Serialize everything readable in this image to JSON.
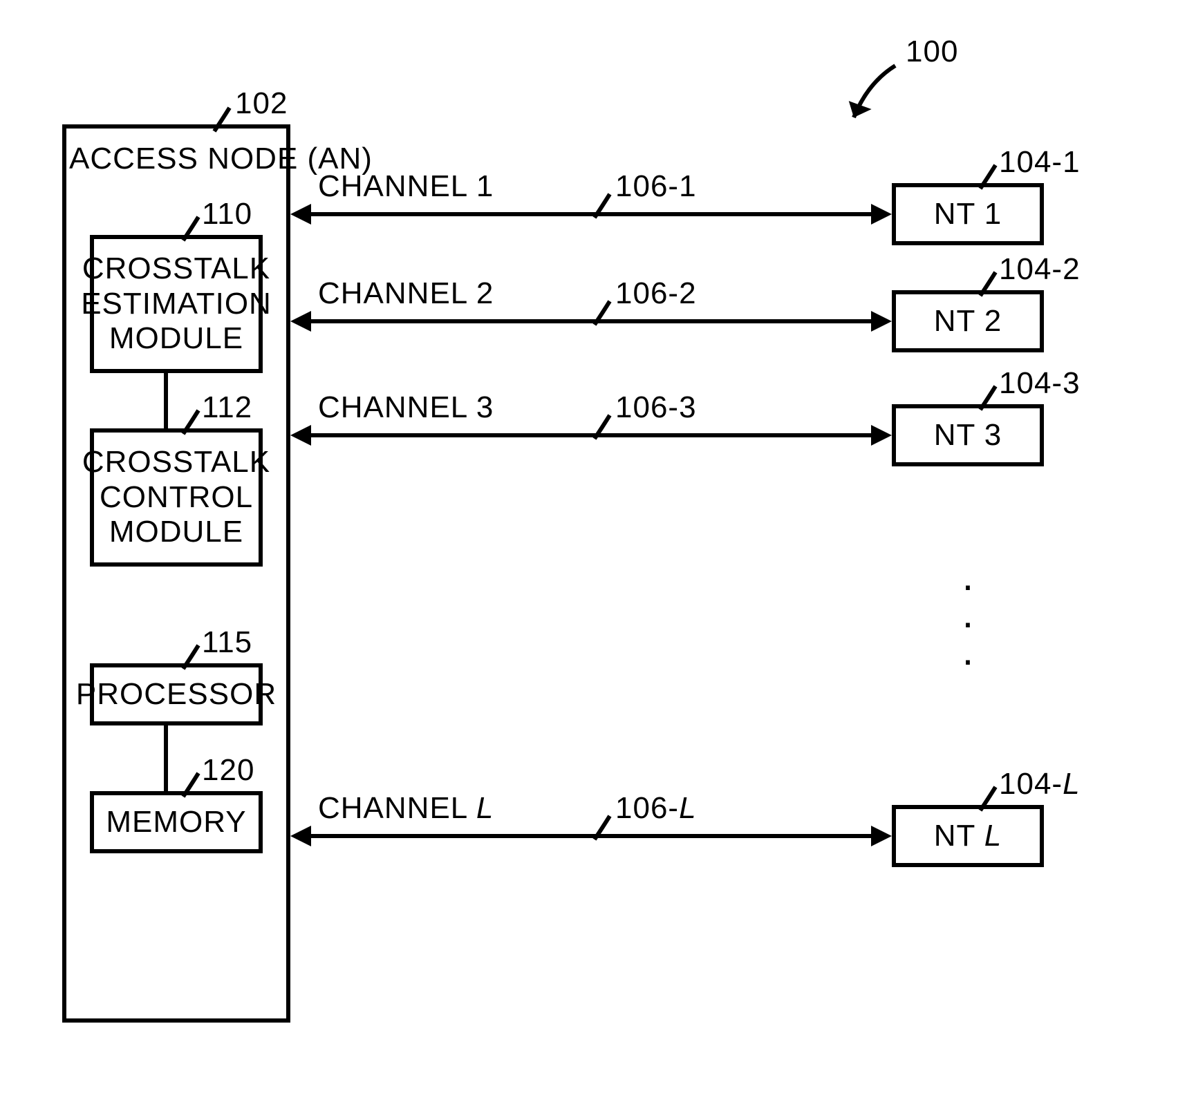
{
  "system_ref": "100",
  "access_node": {
    "title": "ACCESS NODE (AN)",
    "ref": "102",
    "modules": {
      "crosstalk_estimation": {
        "label": "CROSSTALK\nESTIMATION\nMODULE",
        "ref": "110"
      },
      "crosstalk_control": {
        "label": "CROSSTALK\nCONTROL\nMODULE",
        "ref": "112"
      },
      "processor": {
        "label": "PROCESSOR",
        "ref": "115"
      },
      "memory": {
        "label": "MEMORY",
        "ref": "120"
      }
    }
  },
  "channels": [
    {
      "label": "CHANNEL 1",
      "ref": "106-1"
    },
    {
      "label": "CHANNEL 2",
      "ref": "106-2"
    },
    {
      "label": "CHANNEL 3",
      "ref": "106-3"
    },
    {
      "label": "CHANNEL L",
      "ref": "106-L",
      "italic_last": true
    }
  ],
  "terminals": [
    {
      "label": "NT 1",
      "ref": "104-1"
    },
    {
      "label": "NT 2",
      "ref": "104-2"
    },
    {
      "label": "NT 3",
      "ref": "104-3"
    },
    {
      "label": "NT L",
      "ref": "104-L",
      "italic_last": true
    }
  ]
}
